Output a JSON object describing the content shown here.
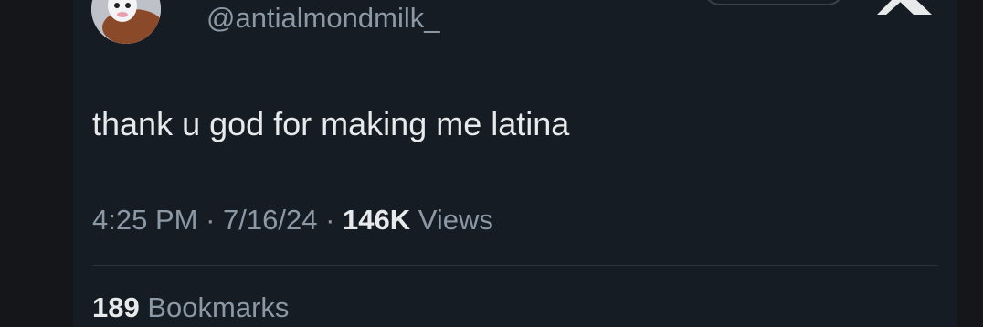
{
  "author": {
    "handle": "@antialmondmilk_"
  },
  "tweet": {
    "text": "thank u god for making me latina",
    "time": "4:25 PM",
    "separator": "·",
    "date": "7/16/24",
    "views_count": "146K",
    "views_label": "Views"
  },
  "stats": {
    "bookmarks_count": "189",
    "bookmarks_label": "Bookmarks"
  },
  "icons": {
    "logo": "x-logo-icon",
    "avatar": "avatar"
  },
  "colors": {
    "background": "#161c24",
    "text_primary": "#e7e9ea",
    "text_secondary": "#8b98a5",
    "divider": "#2f3336"
  }
}
